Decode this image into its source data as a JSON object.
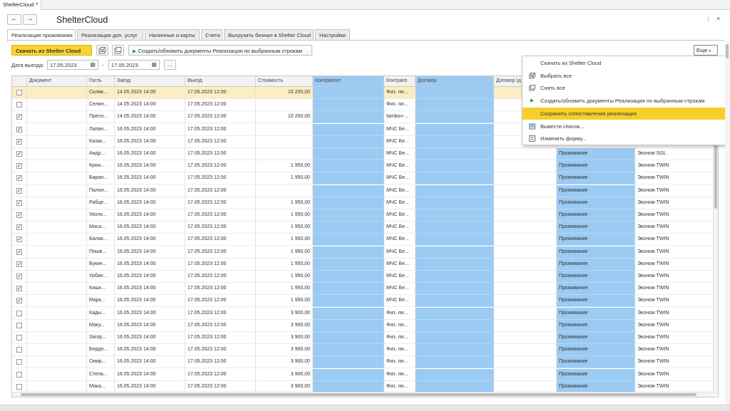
{
  "app_tab": {
    "label": "ShelterCloud",
    "close": "×"
  },
  "window": {
    "title": "ShelterCloud",
    "back": "←",
    "forward": "→",
    "more": "⋮",
    "close": "×"
  },
  "tabs": [
    "Реализация проживания",
    "Реализация доп. услуг",
    "Наличные и карты",
    "Счета",
    "Выгрузить безнал в Shelter Cloud",
    "Настройки"
  ],
  "toolbar": {
    "download_label": "Скачать из Shelter Cloud",
    "create_label": "Создать/обновить документы Реализация по выбранным строкам",
    "more_label": "Еще"
  },
  "filter": {
    "date_label": "Дата выезда:",
    "date_from": "17.05.2023",
    "dash": "-",
    "date_to": "17.05.2023",
    "ellipsis": "..."
  },
  "columns": [
    "Документ",
    "Гость",
    "Заезд",
    "Выезд",
    "Стоимость",
    "Контрагент",
    "Контраге",
    "Договор",
    "Договор (д"
  ],
  "rows": [
    {
      "checked": false,
      "guest": "Силяк...",
      "checkin": "14.05.2023 14:00",
      "checkout": "17.05.2023 12:00",
      "cost": "10 200,00",
      "kontr": "Физ. ли...",
      "service": "",
      "room": "",
      "extra": ""
    },
    {
      "checked": false,
      "guest": "Селин...",
      "checkin": "14.05.2023 14:00",
      "checkout": "17.05.2023 12:00",
      "cost": "",
      "kontr": "Физ. ли...",
      "service": "",
      "room": "",
      "extra": ""
    },
    {
      "checked": true,
      "guest": "Пресн...",
      "checkin": "14.05.2023 14:00",
      "checkout": "17.05.2023 12:00",
      "cost": "10 200,00",
      "kontr": "tambov-...",
      "service": "",
      "room": "",
      "extra": ""
    },
    {
      "checked": true,
      "guest": "Лапан...",
      "checkin": "16.05.2023 14:00",
      "checkout": "17.05.2023 12:00",
      "cost": "",
      "kontr": "МЧС Бе...",
      "service": "",
      "room": "",
      "extra": ""
    },
    {
      "checked": true,
      "guest": "Казак...",
      "checkin": "16.05.2023 14:00",
      "checkout": "17.05.2023 12:00",
      "cost": "",
      "kontr": "МЧС Бе...",
      "service": "",
      "room": "",
      "extra": ""
    },
    {
      "checked": true,
      "guest": "Андр...",
      "checkin": "16.05.2023 14:00",
      "checkout": "17.05.2023 12:00",
      "cost": "",
      "kontr": "МЧС Бе...",
      "service": "Проживание",
      "room": "Эконом SGL",
      "extra": ""
    },
    {
      "checked": true,
      "guest": "Крюк...",
      "checkin": "16.05.2023 14:00",
      "checkout": "17.05.2023 12:00",
      "cost": "1 950,00",
      "kontr": "МЧС Бе...",
      "service": "Проживание",
      "room": "Эконом TWIN",
      "extra": "1!"
    },
    {
      "checked": true,
      "guest": "Баран...",
      "checkin": "16.05.2023 14:00",
      "checkout": "17.05.2023 12:00",
      "cost": "1 950,00",
      "kontr": "МЧС Бе...",
      "service": "Проживание",
      "room": "Эконом TWIN",
      "extra": "1!"
    },
    {
      "checked": true,
      "guest": "Палон...",
      "checkin": "16.05.2023 14:00",
      "checkout": "17.05.2023 12:00",
      "cost": "",
      "kontr": "МЧС Бе...",
      "service": "Проживание",
      "room": "Эконом TWIN",
      "extra": ""
    },
    {
      "checked": true,
      "guest": "Рабце...",
      "checkin": "16.05.2023 14:00",
      "checkout": "17.05.2023 12:00",
      "cost": "1 950,00",
      "kontr": "МЧС Бе...",
      "service": "Проживание",
      "room": "Эконом TWIN",
      "extra": "1!"
    },
    {
      "checked": true,
      "guest": "Уколо...",
      "checkin": "16.05.2023 14:00",
      "checkout": "17.05.2023 12:00",
      "cost": "1 950,00",
      "kontr": "МЧС Бе...",
      "service": "Проживание",
      "room": "Эконом TWIN",
      "extra": "1!"
    },
    {
      "checked": true,
      "guest": "Маса...",
      "checkin": "16.05.2023 14:00",
      "checkout": "17.05.2023 12:00",
      "cost": "1 950,00",
      "kontr": "МЧС Бе...",
      "service": "Проживание",
      "room": "Эконом TWIN",
      "extra": "1!"
    },
    {
      "checked": true,
      "guest": "Балак...",
      "checkin": "16.05.2023 14:00",
      "checkout": "17.05.2023 12:00",
      "cost": "1 950,00",
      "kontr": "МЧС Бе...",
      "service": "Проживание",
      "room": "Эконом TWIN",
      "extra": "1!"
    },
    {
      "checked": true,
      "guest": "Пошв...",
      "checkin": "16.05.2023 14:00",
      "checkout": "17.05.2023 12:00",
      "cost": "1 950,00",
      "kontr": "МЧС Бе...",
      "service": "Проживание",
      "room": "Эконом TWIN",
      "extra": "1!"
    },
    {
      "checked": true,
      "guest": "Букин...",
      "checkin": "16.05.2023 14:00",
      "checkout": "17.05.2023 12:00",
      "cost": "1 950,00",
      "kontr": "МЧС Бе...",
      "service": "Проживание",
      "room": "Эконом TWIN",
      "extra": "1!"
    },
    {
      "checked": true,
      "guest": "Урбан...",
      "checkin": "16.05.2023 14:00",
      "checkout": "17.05.2023 12:00",
      "cost": "1 950,00",
      "kontr": "МЧС Бе...",
      "service": "Проживание",
      "room": "Эконом TWIN",
      "extra": "1!"
    },
    {
      "checked": true,
      "guest": "Кишк...",
      "checkin": "16.05.2023 14:00",
      "checkout": "17.05.2023 12:00",
      "cost": "1 950,00",
      "kontr": "МЧС Бе...",
      "service": "Проживание",
      "room": "Эконом TWIN",
      "extra": "1!"
    },
    {
      "checked": true,
      "guest": "Марк...",
      "checkin": "16.05.2023 14:00",
      "checkout": "17.05.2023 12:00",
      "cost": "1 950,00",
      "kontr": "МЧС Бе...",
      "service": "Проживание",
      "room": "Эконом TWIN",
      "extra": "1!"
    },
    {
      "checked": false,
      "guest": "Кады...",
      "checkin": "16.05.2023 14:00",
      "checkout": "17.05.2023 12:00",
      "cost": "3 900,00",
      "kontr": "Физ. ли...",
      "service": "Проживание",
      "room": "Эконом TWIN",
      "extra": ""
    },
    {
      "checked": false,
      "guest": "Маку...",
      "checkin": "16.05.2023 14:00",
      "checkout": "17.05.2023 12:00",
      "cost": "3 900,00",
      "kontr": "Физ. ли...",
      "service": "Проживание",
      "room": "Эконом TWIN",
      "extra": ""
    },
    {
      "checked": false,
      "guest": "Загор...",
      "checkin": "16.05.2023 14:00",
      "checkout": "17.05.2023 12:00",
      "cost": "3 900,00",
      "kontr": "Физ. ли...",
      "service": "Проживание",
      "room": "Эконом TWIN",
      "extra": ""
    },
    {
      "checked": false,
      "guest": "Бердн...",
      "checkin": "16.05.2023 14:00",
      "checkout": "17.05.2023 12:00",
      "cost": "3 900,00",
      "kontr": "Физ. ли...",
      "service": "Проживание",
      "room": "Эконом TWIN",
      "extra": ""
    },
    {
      "checked": false,
      "guest": "Смир...",
      "checkin": "16.05.2023 14:00",
      "checkout": "17.05.2023 12:00",
      "cost": "3 900,00",
      "kontr": "Физ. ли...",
      "service": "Проживание",
      "room": "Эконом TWIN",
      "extra": ""
    },
    {
      "checked": false,
      "guest": "Степа...",
      "checkin": "16.05.2023 14:00",
      "checkout": "17.05.2023 12:00",
      "cost": "3 900,00",
      "kontr": "Физ. ли...",
      "service": "Проживание",
      "room": "Эконом TWIN",
      "extra": ""
    },
    {
      "checked": false,
      "guest": "Мака...",
      "checkin": "16.05.2023 14:00",
      "checkout": "17.05.2023 12:00",
      "cost": "3 900,00",
      "kontr": "Физ. ли...",
      "service": "Проживание",
      "room": "Эконом TWIN",
      "extra": ""
    }
  ],
  "menu": [
    {
      "label": "Скачать из Shelter Cloud",
      "icon": "none",
      "highlighted": false
    },
    {
      "label": "Выбрать все",
      "icon": "check-all-icon",
      "highlighted": false
    },
    {
      "label": "Снять все",
      "icon": "uncheck-all-icon",
      "highlighted": false
    },
    {
      "label": "Создать/обновить документы Реализация по выбранным строкам",
      "icon": "play-icon",
      "highlighted": false
    },
    {
      "label": "Сохранить сопоставления реализация",
      "icon": "none",
      "highlighted": true
    },
    {
      "label": "Вывести список...",
      "icon": "list-output-icon",
      "highlighted": false
    },
    {
      "label": "Изменить форму...",
      "icon": "form-settings-icon",
      "highlighted": false
    }
  ],
  "colors": {
    "accent": "#f7d431",
    "highlight_column": "#9bcaf3",
    "selected_row": "#fbeec1",
    "check": "#2e8b2e"
  }
}
